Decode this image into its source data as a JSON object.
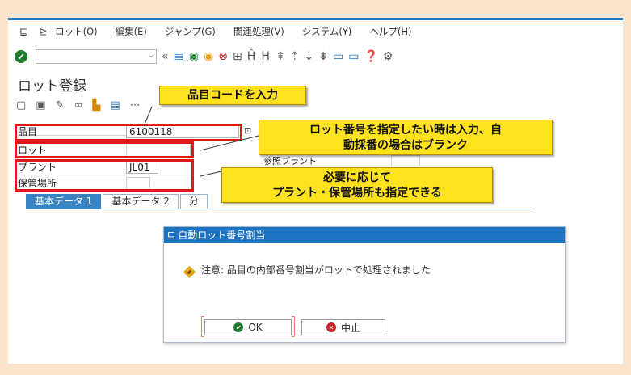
{
  "menu": {
    "items": [
      "ロット(O)",
      "編集(E)",
      "ジャンプ(G)",
      "関連処理(V)",
      "システム(Y)",
      "ヘルプ(H)"
    ]
  },
  "toolbar": {
    "command_value": "",
    "icons": [
      "ok-icon",
      "back-icon",
      "save-icon",
      "back-nav-icon",
      "exit-icon",
      "cancel-icon",
      "print-icon",
      "find-icon",
      "find-next-icon",
      "first-page-icon",
      "prev-page-icon",
      "next-page-icon",
      "last-page-icon",
      "new-session-icon",
      "shortcut-icon",
      "help-icon",
      "settings-icon"
    ]
  },
  "page": {
    "title": "ロット登録"
  },
  "fields": {
    "material_label": "品目",
    "material_value": "6100118",
    "batch_label": "ロット",
    "batch_value": "",
    "plant_label": "プラント",
    "plant_value": "JL01",
    "storage_label": "保管場所",
    "storage_value": "",
    "ref_plant_label": "参照プラント"
  },
  "tabs": [
    {
      "label": "基本データ 1",
      "active": true
    },
    {
      "label": "基本データ 2",
      "active": false
    },
    {
      "label": "分",
      "active": false
    }
  ],
  "callouts": {
    "material": "品目コードを入力",
    "batch_line1": "ロット番号を指定したい時は入力、自",
    "batch_line2": "動採番の場合はブランク",
    "plant_line1": "必要に応じて",
    "plant_line2": "プラント・保管場所も指定できる"
  },
  "dialog": {
    "title": "自動ロット番号割当",
    "message": "注意: 品目の内部番号割当がロットで処理されました",
    "ok_label": "OK",
    "cancel_label": "中止"
  },
  "colors": {
    "background": "#fbe5cf",
    "sap_blue": "#1c73c2",
    "highlight_red": "#e0181b",
    "callout_yellow": "#ffe21e"
  }
}
